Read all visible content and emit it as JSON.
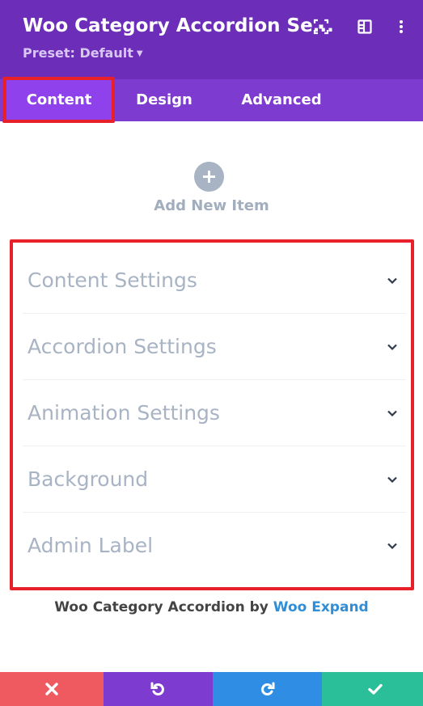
{
  "header": {
    "title": "Woo Category Accordion Se...",
    "preset": "Preset: Default",
    "icons": [
      "focus-icon",
      "split-view-icon",
      "more-options-icon"
    ]
  },
  "tabs": [
    {
      "label": "Content",
      "active": true
    },
    {
      "label": "Design",
      "active": false
    },
    {
      "label": "Advanced",
      "active": false
    }
  ],
  "add_item": {
    "label": "Add New Item",
    "icon": "plus-icon"
  },
  "sections": [
    {
      "label": "Content Settings"
    },
    {
      "label": "Accordion Settings"
    },
    {
      "label": "Animation Settings"
    },
    {
      "label": "Background"
    },
    {
      "label": "Admin Label"
    }
  ],
  "credit": {
    "text": "Woo Category Accordion by",
    "link": "Woo Expand"
  },
  "footer": {
    "buttons": [
      {
        "icon": "close-icon",
        "color": "#ee5a5f"
      },
      {
        "icon": "undo-icon",
        "color": "#7e3bd0"
      },
      {
        "icon": "redo-icon",
        "color": "#2f8ee3"
      },
      {
        "icon": "checkmark-icon",
        "color": "#2bbf99"
      }
    ]
  },
  "colors": {
    "header_bg": "#6c2eb9",
    "tabs_bg": "#7e3bd0",
    "active_tab_bg": "#8f42ec",
    "highlight_outline": "#e8202a"
  }
}
